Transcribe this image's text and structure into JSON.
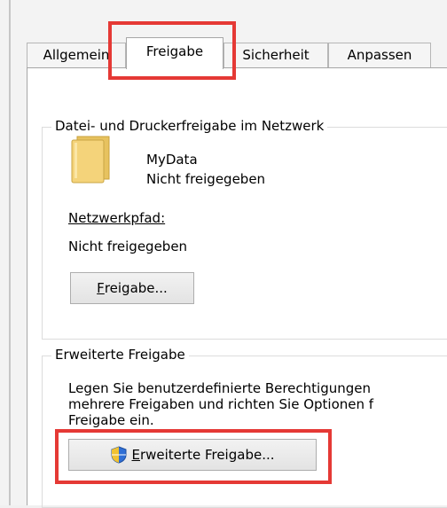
{
  "tabs": [
    "Allgemein",
    "Freigabe",
    "Sicherheit",
    "Anpassen"
  ],
  "sharing": {
    "group_title": "Datei- und Druckerfreigabe im Netzwerk",
    "item_name": "MyData",
    "item_status": "Nicht freigegeben",
    "path_label": "Netzwerkpfad:",
    "path_value": "Nicht freigegeben",
    "share_button_first": "F",
    "share_button_rest": "reigabe..."
  },
  "advanced": {
    "group_title": "Erweiterte Freigabe",
    "line1": "Legen Sie benutzerdefinierte Berechtigungen",
    "line2": "mehrere Freigaben und richten Sie Optionen f",
    "line3": "Freigabe ein.",
    "button_first": "E",
    "button_rest": "rweiterte Freigabe..."
  },
  "colors": {
    "highlight": "#e53935",
    "folder": "#f4d37a",
    "shield_blue": "#2f6fd6",
    "shield_yellow": "#f1c232"
  }
}
